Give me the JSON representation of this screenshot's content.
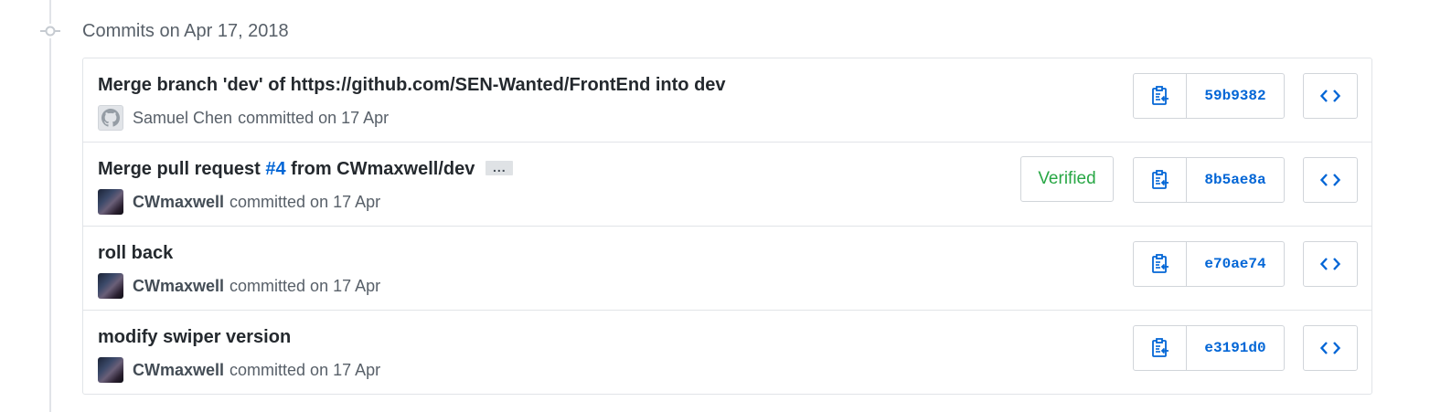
{
  "group": {
    "date_title": "Commits on Apr 17, 2018"
  },
  "colors": {
    "link": "#0366d6",
    "verified": "#28a745",
    "border": "#e1e4e8",
    "muted_text": "#586069"
  },
  "commits": [
    {
      "title": "Merge branch 'dev' of https://github.com/SEN-Wanted/FrontEnd into dev",
      "author": "Samuel Chen",
      "committed_text": "committed on 17 Apr",
      "sha": "59b9382",
      "avatar_icon": "github-octocat-icon",
      "verified": false
    },
    {
      "title_prefix": "Merge pull request ",
      "pr_link": "#4",
      "title_suffix": " from CWmaxwell/dev",
      "ellipsis": "...",
      "author": "CWmaxwell",
      "committed_text": "committed on 17 Apr",
      "sha": "8b5ae8a",
      "avatar_icon": "user-avatar",
      "verified": true,
      "verified_label": "Verified"
    },
    {
      "title": "roll back",
      "author": "CWmaxwell",
      "committed_text": "committed on 17 Apr",
      "sha": "e70ae74",
      "avatar_icon": "user-avatar",
      "verified": false
    },
    {
      "title": "modify swiper version",
      "author": "CWmaxwell",
      "committed_text": "committed on 17 Apr",
      "sha": "e3191d0",
      "avatar_icon": "user-avatar",
      "verified": false
    }
  ],
  "icons": {
    "copy": "clippy-icon",
    "browse": "code-icon",
    "timeline": "commit-node-icon"
  }
}
